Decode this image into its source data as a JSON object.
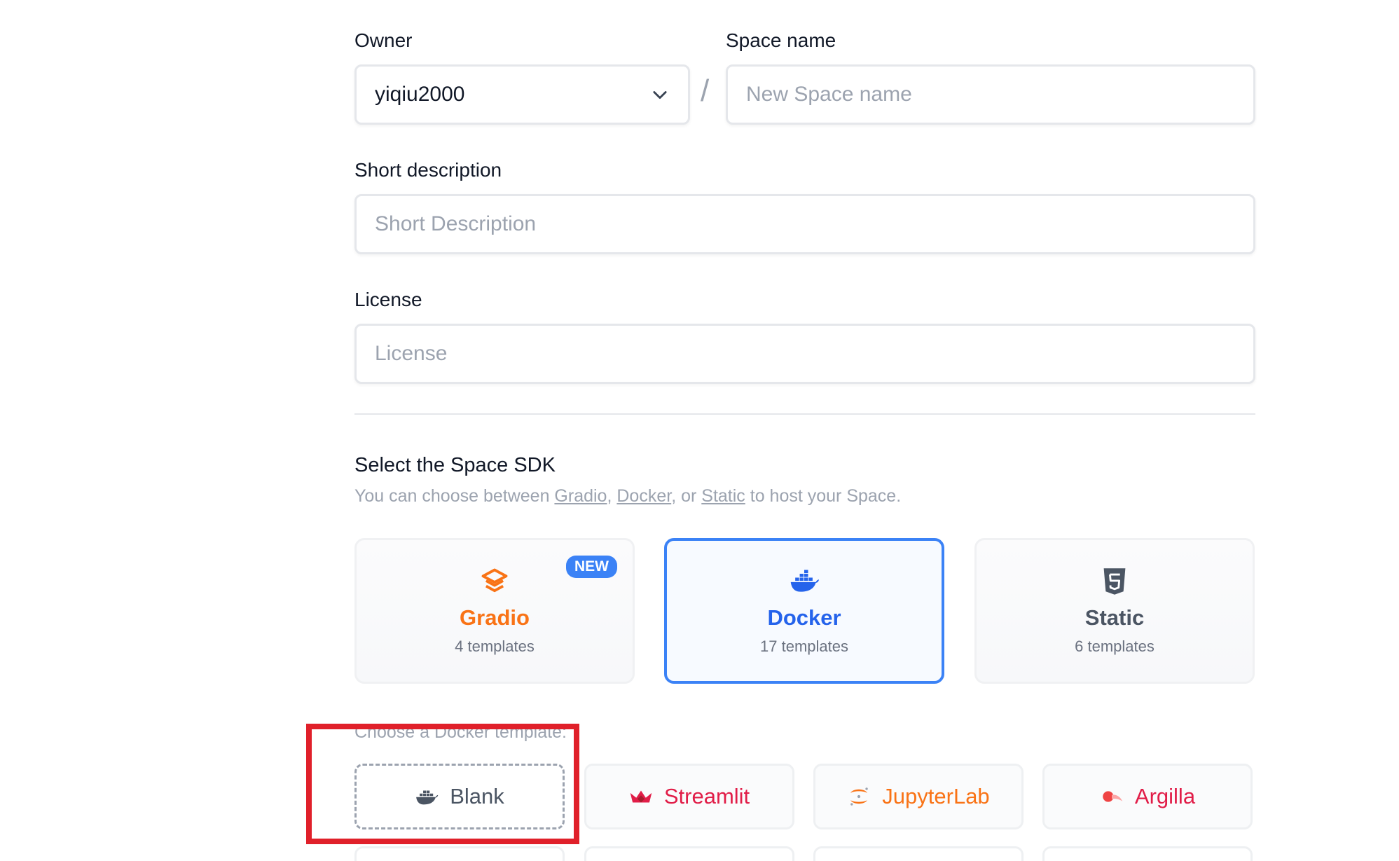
{
  "owner": {
    "label": "Owner",
    "value": "yiqiu2000"
  },
  "separator": "/",
  "space_name": {
    "label": "Space name",
    "placeholder": "New Space name"
  },
  "short_description": {
    "label": "Short description",
    "placeholder": "Short Description"
  },
  "license": {
    "label": "License",
    "placeholder": "License"
  },
  "sdk": {
    "title": "Select the Space SDK",
    "subtitle_prefix": "You can choose between ",
    "link_gradio": "Gradio",
    "comma": ", ",
    "link_docker": "Docker",
    "or_text": ", or ",
    "link_static": "Static",
    "subtitle_suffix": " to host your Space.",
    "cards": [
      {
        "name": "Gradio",
        "count": "4 templates",
        "badge": "NEW",
        "color": "#f97316",
        "icon": "gradio-icon"
      },
      {
        "name": "Docker",
        "count": "17 templates",
        "color": "#2563eb",
        "icon": "docker-icon",
        "selected": true
      },
      {
        "name": "Static",
        "count": "6 templates",
        "color": "#4b5563",
        "icon": "html5-icon"
      }
    ]
  },
  "docker_templates": {
    "label": "Choose a Docker template:",
    "items": [
      {
        "name": "Blank",
        "color": "#4b5563",
        "icon": "docker-icon",
        "selected": true
      },
      {
        "name": "Streamlit",
        "color": "#e11d48",
        "icon": "streamlit-icon"
      },
      {
        "name": "JupyterLab",
        "color": "#f97316",
        "icon": "jupyter-icon"
      },
      {
        "name": "Argilla",
        "color": "#e11d48",
        "icon": "argilla-icon"
      }
    ]
  }
}
